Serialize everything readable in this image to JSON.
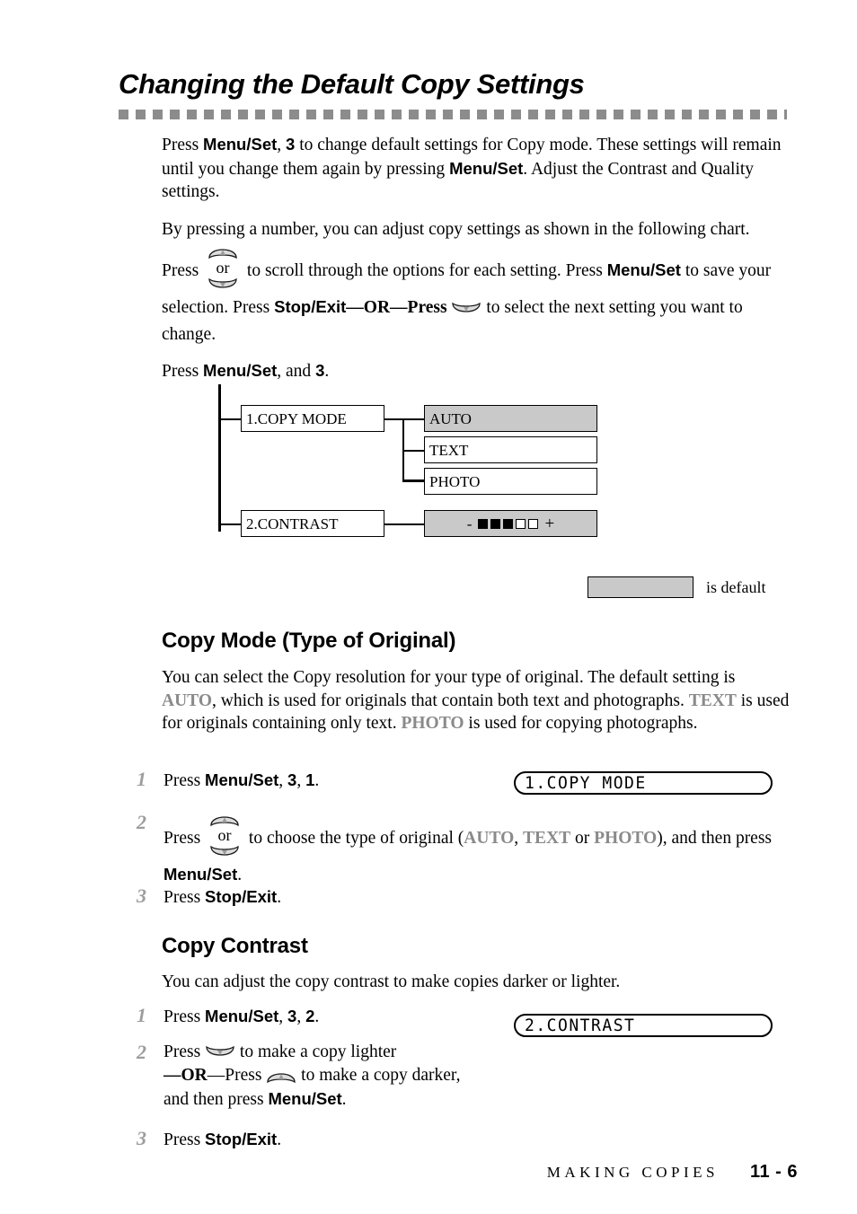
{
  "header": {
    "title": "Changing the Default Copy Settings"
  },
  "intro": {
    "p1_a": "Press ",
    "p1_menuset": "Menu/Set",
    "p1_b": ", ",
    "p1_three": "3",
    "p1_c": " to change default settings for Copy mode. These settings will remain until you change them again by pressing ",
    "p1_menuset2": "Menu/Set",
    "p1_d": ". Adjust the Contrast and Quality settings.",
    "p2_a": "By pressing a number, you can adjust copy settings as shown in the following chart. Press ",
    "p2_b": " to scroll through the options for each setting. Press ",
    "p2_menuset": "Menu/Set",
    "p2_c": " to save your selection. Press ",
    "p2_stopexit": "Stop/Exit",
    "p2_d": "—",
    "p2_or": "OR",
    "p2_e": "—Press ",
    "p2_f": " to select the next setting you want to change.",
    "p3_a": "Press ",
    "p3_menuset": "Menu/Set",
    "p3_b": ", and ",
    "p3_three": "3",
    "p3_c": "."
  },
  "icon_labels": {
    "or": "or",
    "up_key": "up-arrow-key",
    "down_key": "down-arrow-key"
  },
  "tree": {
    "menu_items": [
      {
        "label": "1.COPY MODE"
      },
      {
        "label": "2.CONTRAST"
      }
    ],
    "copy_mode_options": [
      {
        "label": "AUTO",
        "default": true
      },
      {
        "label": "TEXT",
        "default": false
      },
      {
        "label": "PHOTO",
        "default": false
      }
    ],
    "contrast_option": {
      "minus": "-",
      "plus": "+",
      "filled_blocks": 3,
      "empty_blocks": 2,
      "default": true
    },
    "legend_label": "is default"
  },
  "copy_mode_section": {
    "heading": "Copy Mode (Type of Original)",
    "body_a": "You can select the Copy resolution for your type of original. The default setting is ",
    "body_auto": "AUTO",
    "body_b": ", which is used for originals that contain both text and photographs. ",
    "body_text": "TEXT",
    "body_c": " is used for originals containing only text. ",
    "body_photo": "PHOTO",
    "body_d": " is used for copying photographs.",
    "steps": [
      {
        "num": "1",
        "t_a": "Press ",
        "t_bold": "Menu/Set",
        "t_b": ", ",
        "t_bold2": "3",
        "t_c": ", ",
        "t_bold3": "1",
        "t_d": "."
      },
      {
        "num": "2",
        "t_a": "Press ",
        "t_b": " to choose the type of original (",
        "t_auto": "AUTO",
        "t_c": ", ",
        "t_text": "TEXT",
        "t_d": " or ",
        "t_photo": "PHOTO",
        "t_e": "), and then press ",
        "t_bold": "Menu/Set",
        "t_f": "."
      },
      {
        "num": "3",
        "t_a": "Press ",
        "t_bold": "Stop/Exit",
        "t_b": "."
      }
    ],
    "lcd": "1.COPY MODE"
  },
  "copy_contrast_section": {
    "heading": "Copy Contrast",
    "body": "You can adjust the copy contrast to make copies darker or lighter.",
    "steps": [
      {
        "num": "1",
        "t_a": "Press ",
        "t_bold": "Menu/Set",
        "t_b": ", ",
        "t_bold2": "3",
        "t_c": ", ",
        "t_bold3": "2",
        "t_d": "."
      },
      {
        "num": "2",
        "t_a": "Press ",
        "t_b": " to make a copy lighter",
        "t_or_dash1": "—",
        "t_or": "OR",
        "t_or_dash2": "—Press ",
        "t_c": " to make a copy darker,",
        "t_d": "and then press ",
        "t_bold": "Menu/Set",
        "t_e": "."
      },
      {
        "num": "3",
        "t_a": "Press ",
        "t_bold": "Stop/Exit",
        "t_b": "."
      }
    ],
    "lcd": "2.CONTRAST"
  },
  "footer": {
    "section": "MAKING COPIES",
    "page": "11 - 6"
  },
  "colors": {
    "shaded_cell": "#c9c9c9",
    "gray_term": "#8a8a8a",
    "step_number": "#9d9d9d",
    "rule_dash": "#8c8c8c"
  }
}
